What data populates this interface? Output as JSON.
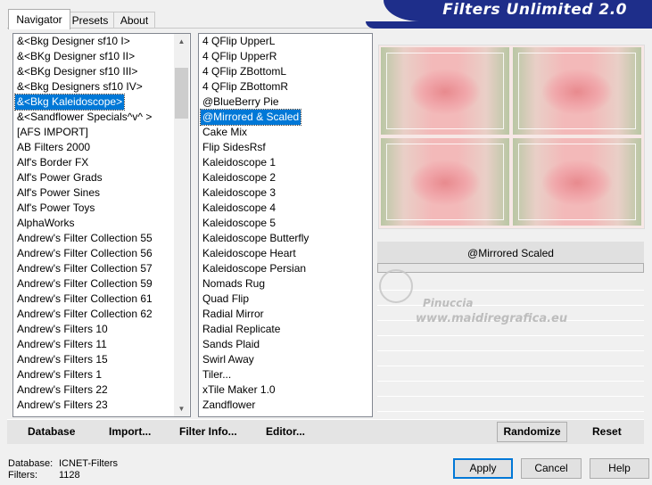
{
  "banner": {
    "title": "Filters Unlimited 2.0"
  },
  "tabs": [
    {
      "label": "Navigator",
      "active": true
    },
    {
      "label": "Presets",
      "active": false
    },
    {
      "label": "About",
      "active": false
    }
  ],
  "categories": {
    "items": [
      "&<Bkg Designer sf10 I>",
      "&<BKg Designer sf10 II>",
      "&<BKg Designer sf10 III>",
      "&<Bkg Designers sf10 IV>",
      "&<Bkg Kaleidoscope>",
      "&<Sandflower Specials^v^ >",
      "[AFS IMPORT]",
      "AB Filters 2000",
      "Alf's Border FX",
      "Alf's Power Grads",
      "Alf's Power Sines",
      "Alf's Power Toys",
      "AlphaWorks",
      "Andrew's Filter Collection 55",
      "Andrew's Filter Collection 56",
      "Andrew's Filter Collection 57",
      "Andrew's Filter Collection 59",
      "Andrew's Filter Collection 61",
      "Andrew's Filter Collection 62",
      "Andrew's Filters 10",
      "Andrew's Filters 11",
      "Andrew's Filters 15",
      "Andrew's Filters 1",
      "Andrew's Filters 22",
      "Andrew's Filters 23"
    ],
    "selected": "&<Bkg Kaleidoscope>"
  },
  "filters": {
    "items": [
      "4 QFlip UpperL",
      "4 QFlip UpperR",
      "4 QFlip ZBottomL",
      "4 QFlip ZBottomR",
      "@BlueBerry Pie",
      "@Mirrored & Scaled",
      "Cake Mix",
      "Flip SidesRsf",
      "Kaleidoscope 1",
      "Kaleidoscope 2",
      "Kaleidoscope 3",
      "Kaleidoscope 4",
      "Kaleidoscope 5",
      "Kaleidoscope Butterfly",
      "Kaleidoscope Heart",
      "Kaleidoscope Persian",
      "Nomads Rug",
      "Quad Flip",
      "Radial Mirror",
      "Radial Replicate",
      "Sands Plaid",
      "Swirl Away",
      "Tiler...",
      "xTile Maker 1.0",
      "Zandflower"
    ],
    "selected": "@Mirrored & Scaled"
  },
  "preview": {
    "filter_name": "@Mirrored  Scaled"
  },
  "watermark": {
    "line1": "Pinuccia",
    "line2": "www.maidiregrafica.eu"
  },
  "toolbar": {
    "database": "Database",
    "import": "Import...",
    "filter_info": "Filter Info...",
    "editor": "Editor...",
    "randomize": "Randomize",
    "reset": "Reset"
  },
  "status": {
    "database_label": "Database:",
    "database_value": "ICNET-Filters",
    "filters_label": "Filters:",
    "filters_value": "1128"
  },
  "buttons": {
    "apply": "Apply",
    "cancel": "Cancel",
    "help": "Help"
  },
  "colors": {
    "banner": "#1e2e8a",
    "selection": "#0078d7"
  }
}
